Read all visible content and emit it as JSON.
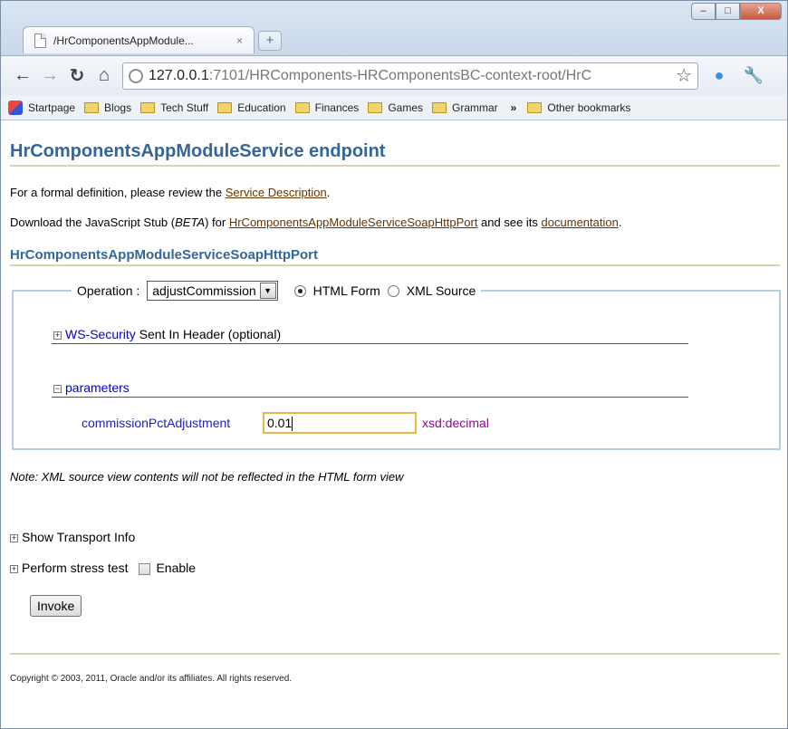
{
  "browser": {
    "tab_title": "/HrComponentsAppModule...",
    "tab_close": "×",
    "new_tab": "+",
    "window_buttons": {
      "minimize": "–",
      "maximize": "□",
      "close": "X"
    },
    "url_host": "127.0.0.1",
    "url_rest": ":7101/HRComponents-HRComponentsBC-context-root/HrC",
    "bookmarks": [
      "Startpage",
      "Blogs",
      "Tech Stuff",
      "Education",
      "Finances",
      "Games",
      "Grammar"
    ],
    "bookmarks_more": "»",
    "other_bookmarks": "Other bookmarks"
  },
  "page": {
    "title": "HrComponentsAppModuleService endpoint",
    "formal_prefix": "For a formal definition, please review the ",
    "service_description_link": "Service Description",
    "formal_suffix": ".",
    "stub_prefix": "Download the JavaScript Stub (",
    "stub_beta": "BETA",
    "stub_mid": ") for ",
    "stub_port_link": "HrComponentsAppModuleServiceSoapHttpPort",
    "stub_and": " and see its ",
    "stub_doc_link": "documentation",
    "stub_suffix": ".",
    "port_heading": "HrComponentsAppModuleServiceSoapHttpPort",
    "operation_label": "Operation :",
    "operation_value": "adjustCommission",
    "html_form_label": "HTML Form",
    "xml_source_label": "XML Source",
    "ws_security_link": "WS-Security",
    "ws_security_text": " Sent In Header (optional)",
    "parameters_label": "parameters",
    "param_name": "commissionPctAdjustment",
    "param_value": "0.01",
    "param_type": "xsd:decimal",
    "note": "Note: XML source view contents will not be reflected in the HTML form view",
    "show_transport": "Show Transport Info",
    "stress_test": "Perform stress test",
    "enable_label": "Enable",
    "invoke_label": "Invoke",
    "copyright": "Copyright © 2003, 2011, Oracle and/or its affiliates. All rights reserved."
  }
}
